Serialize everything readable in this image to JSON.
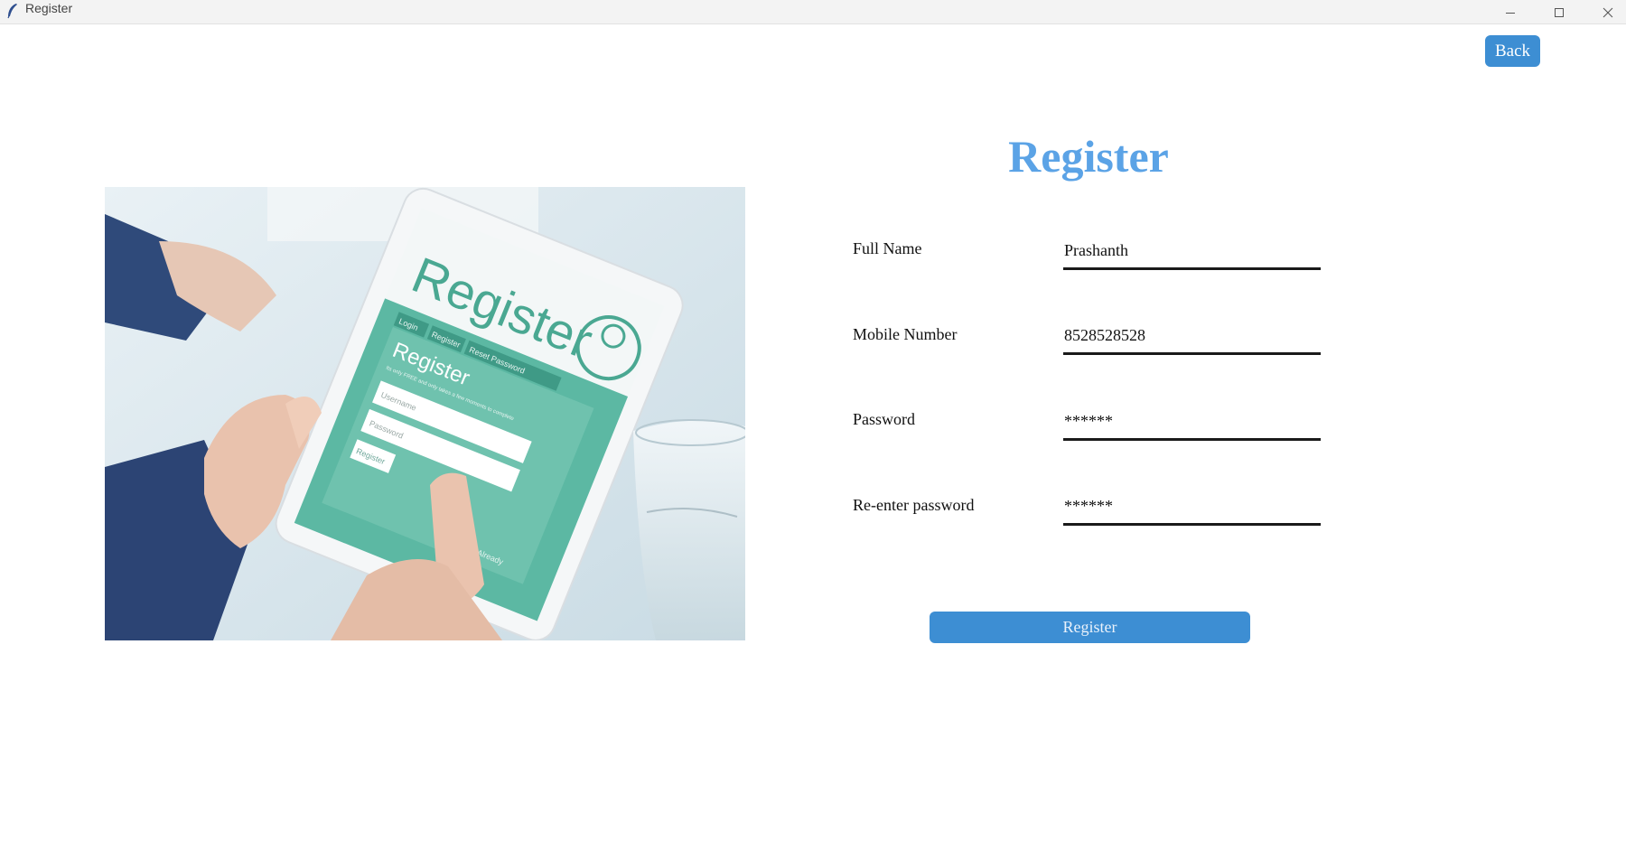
{
  "window": {
    "title": "Register",
    "icon": "feather-icon"
  },
  "header": {
    "back_label": "Back"
  },
  "illustration": {
    "screen_heading": "Register",
    "tab_login": "Login",
    "tab_register": "Register",
    "tab_reset": "Reset Password",
    "panel_title": "Register",
    "panel_subtitle": "Its only FREE and only takes a few moments to complete",
    "username_placeholder": "Username",
    "password_placeholder": "Password",
    "button_label": "Register",
    "footer_fragment": "Already"
  },
  "form": {
    "title": "Register",
    "fields": [
      {
        "label": "Full Name",
        "value": "Prashanth"
      },
      {
        "label": "Mobile Number",
        "value": "8528528528"
      },
      {
        "label": "Password",
        "value": "******"
      },
      {
        "label": "Re-enter password",
        "value": "******"
      }
    ],
    "submit_label": "Register"
  },
  "colors": {
    "accent": "#3d8ed3",
    "heading": "#5ba3e6",
    "tablet_teal": "#5cb8a3"
  }
}
